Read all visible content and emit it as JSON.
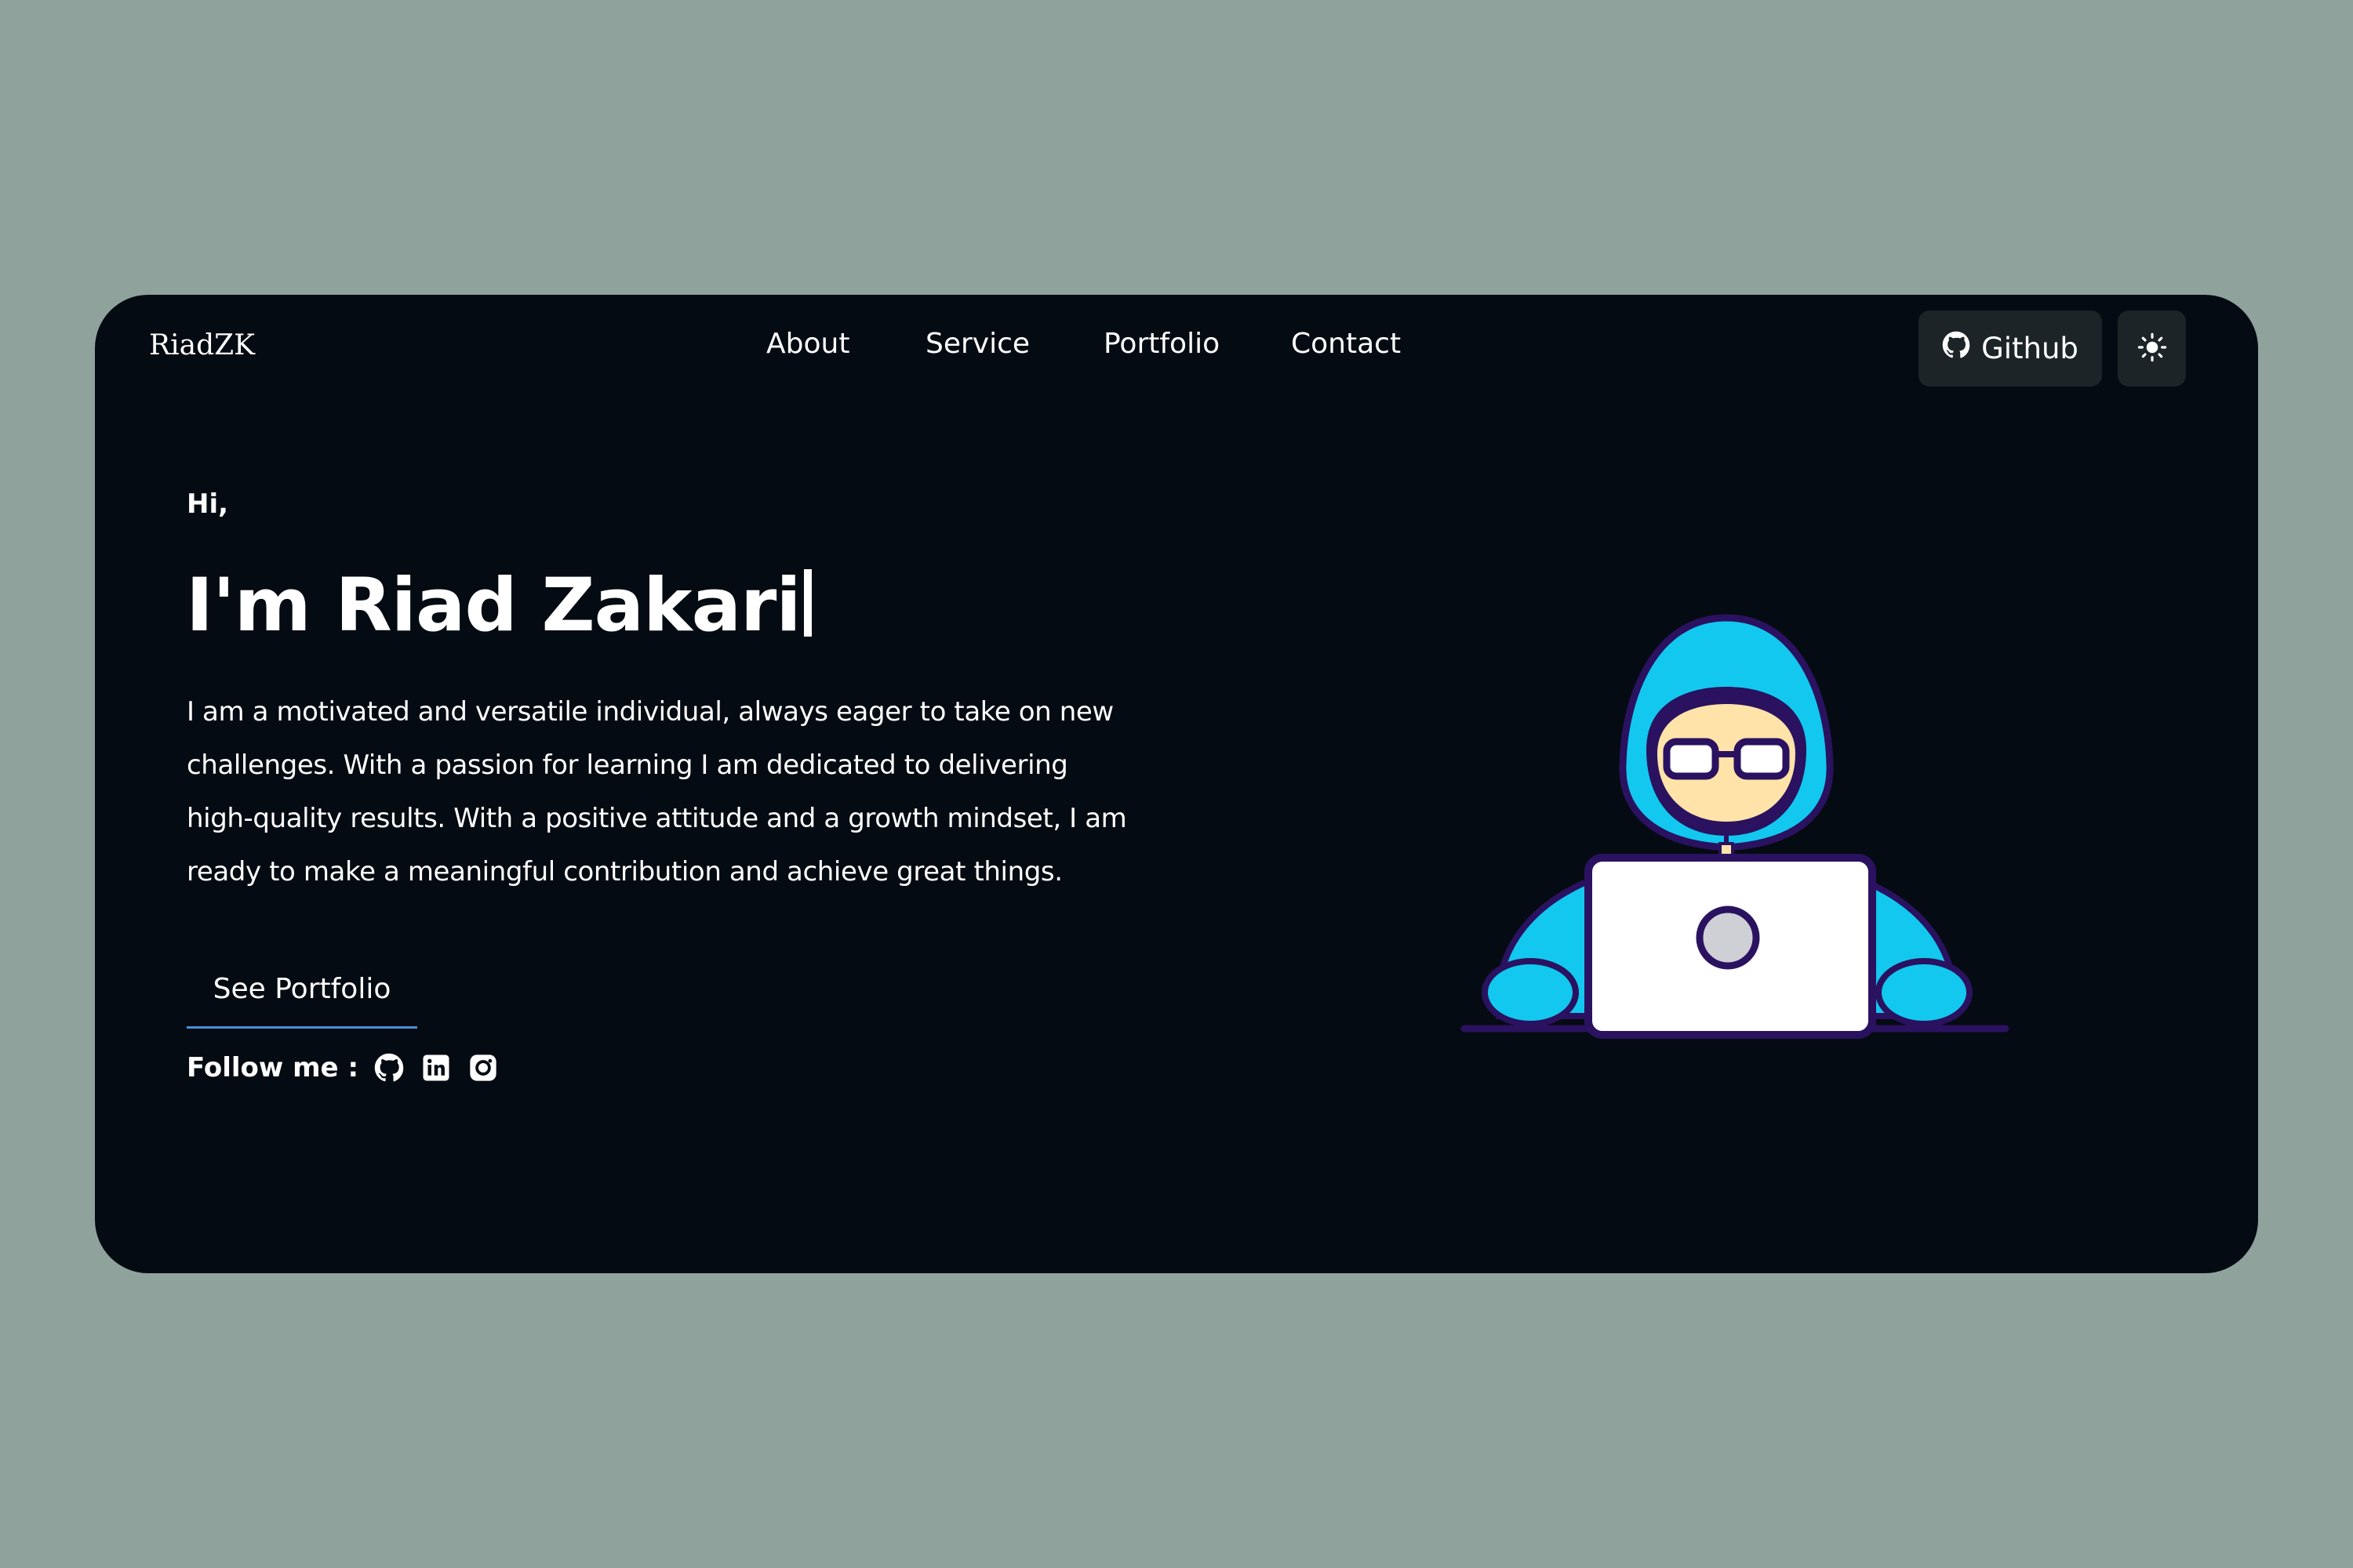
{
  "brand": {
    "logo": "RiadZK"
  },
  "nav": {
    "items": [
      "About",
      "Service",
      "Portfolio",
      "Contact"
    ],
    "github_label": "Github"
  },
  "hero": {
    "greeting": "Hi,",
    "headline": "I'm Riad Zakari",
    "bio": "I am a motivated and versatile individual, always eager to take on new challenges. With a passion for learning I am dedicated to delivering high-quality results. With a positive attitude and a growth mindset, I am ready to make a meaningful contribution and achieve great things.",
    "cta_label": "See Portfolio",
    "follow_label": "Follow me :",
    "social_icons": [
      "github-icon",
      "linkedin-icon",
      "instagram-icon"
    ]
  },
  "colors": {
    "page_background": "#8fa39c",
    "card_background": "#050b12",
    "button_background": "#1c2427",
    "accent_underline": "#4a8fd8",
    "hoodie": "#12c8ef",
    "outline": "#2a1260"
  }
}
